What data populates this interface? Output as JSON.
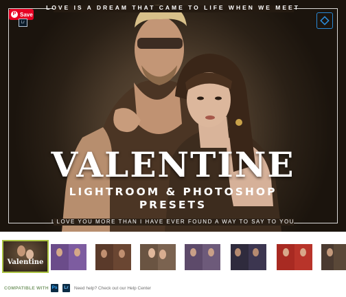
{
  "pin_button": {
    "label": "Save",
    "icon": "pinterest-icon"
  },
  "hero": {
    "tagline_top": "LOVE IS A DREAM THAT CAME TO LIFE WHEN WE MEET",
    "title": "VALENTINE",
    "subtitle_line1": "LIGHTROOM & PHOTOSHOP",
    "subtitle_line2": "PRESETS",
    "tagline_bottom": "I LOVE YOU MORE THAN I HAVE EVER FOUND A WAY TO SAY TO YOU",
    "corner_badge": "Lr",
    "brand_icon": "diamond-logo-icon"
  },
  "thumbnails": [
    {
      "caption": "Valentine",
      "active": true
    },
    {
      "caption": "",
      "active": false
    },
    {
      "caption": "",
      "active": false
    },
    {
      "caption": "",
      "active": false
    },
    {
      "caption": "",
      "active": false
    },
    {
      "caption": "",
      "active": false
    },
    {
      "caption": "",
      "active": false
    },
    {
      "caption": "",
      "active": false
    }
  ],
  "compatibility": {
    "label": "COMPATIBLE WITH",
    "apps": [
      "Ps",
      "Lr"
    ],
    "help_text": "Need help? Check out our Help Center"
  },
  "colors": {
    "pinterest_red": "#e60023",
    "active_thumb_border": "#a9c23f",
    "ps_blue": "#001e36",
    "lr_blue": "#001e36",
    "compat_label": "#7a9b6a"
  }
}
